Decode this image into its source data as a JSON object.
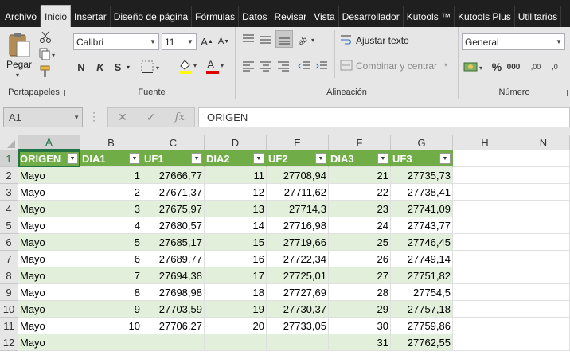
{
  "tabs": [
    "Archivo",
    "Inicio",
    "Insertar",
    "Diseño de página",
    "Fórmulas",
    "Datos",
    "Revisar",
    "Vista",
    "Desarrollador",
    "Kutools ™",
    "Kutools Plus",
    "Utilitarios"
  ],
  "active_tab": "Inicio",
  "ribbon": {
    "clipboard": {
      "label": "Portapapeles",
      "paste_label": "Pegar"
    },
    "font": {
      "label": "Fuente",
      "font_name": "Calibri",
      "font_size": "11",
      "bold": "N",
      "italic": "K",
      "underline": "S"
    },
    "alignment": {
      "label": "Alineación",
      "wrap_text": "Ajustar texto",
      "merge_center": "Combinar y centrar"
    },
    "number": {
      "label": "Número",
      "format": "General",
      "percent": "%",
      "thousands": "000",
      "inc_decimal": ",00",
      "dec_decimal": ",0"
    }
  },
  "formula_bar": {
    "name_box": "A1",
    "fx_label": "fx",
    "content": "ORIGEN"
  },
  "columns": [
    "A",
    "B",
    "C",
    "D",
    "E",
    "F",
    "G",
    "H",
    "N"
  ],
  "rows": [
    "1",
    "2",
    "3",
    "4",
    "5",
    "6",
    "7",
    "8",
    "9",
    "10",
    "11",
    "12"
  ],
  "table": {
    "headers": [
      "ORIGEN",
      "DIA1",
      "UF1",
      "DIA2",
      "UF2",
      "DIA3",
      "UF3"
    ],
    "rows": [
      [
        "Mayo",
        "1",
        "27666,77",
        "11",
        "27708,94",
        "21",
        "27735,73"
      ],
      [
        "Mayo",
        "2",
        "27671,37",
        "12",
        "27711,62",
        "22",
        "27738,41"
      ],
      [
        "Mayo",
        "3",
        "27675,97",
        "13",
        "27714,3",
        "23",
        "27741,09"
      ],
      [
        "Mayo",
        "4",
        "27680,57",
        "14",
        "27716,98",
        "24",
        "27743,77"
      ],
      [
        "Mayo",
        "5",
        "27685,17",
        "15",
        "27719,66",
        "25",
        "27746,45"
      ],
      [
        "Mayo",
        "6",
        "27689,77",
        "16",
        "27722,34",
        "26",
        "27749,14"
      ],
      [
        "Mayo",
        "7",
        "27694,38",
        "17",
        "27725,01",
        "27",
        "27751,82"
      ],
      [
        "Mayo",
        "8",
        "27698,98",
        "18",
        "27727,69",
        "28",
        "27754,5"
      ],
      [
        "Mayo",
        "9",
        "27703,59",
        "19",
        "27730,37",
        "29",
        "27757,18"
      ],
      [
        "Mayo",
        "10",
        "27706,27",
        "20",
        "27733,05",
        "30",
        "27759,86"
      ],
      [
        "Mayo",
        "",
        "",
        "",
        "",
        "31",
        "27762,55"
      ]
    ]
  },
  "colors": {
    "header_green": "#70ad47",
    "band_green": "#e2efda",
    "excel_green": "#217346",
    "ribbon_bg": "#e6e6e6",
    "menubar_bg": "#1f1f1f"
  }
}
